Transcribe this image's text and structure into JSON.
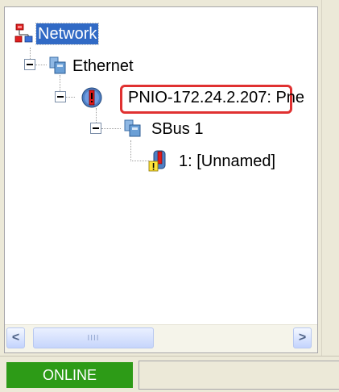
{
  "tree": {
    "nodes": [
      {
        "label": "Network",
        "icon": "network-root-icon"
      },
      {
        "label": "Ethernet",
        "icon": "ethernet-icon"
      },
      {
        "label": "PNIO-172.24.2.207: Pne",
        "icon": "device-error-icon"
      },
      {
        "label": "SBus 1",
        "icon": "bus-icon"
      },
      {
        "label": "1: [Unnamed]",
        "icon": "module-warning-icon"
      }
    ]
  },
  "scrollbar": {
    "left_arrow": "<",
    "right_arrow": ">",
    "thumb_grip": "IIII"
  },
  "status_bar": {
    "online_label": "ONLINE"
  },
  "colors": {
    "selection": "#316ac5",
    "highlight": "#e03131",
    "online": "#2d9b17"
  }
}
